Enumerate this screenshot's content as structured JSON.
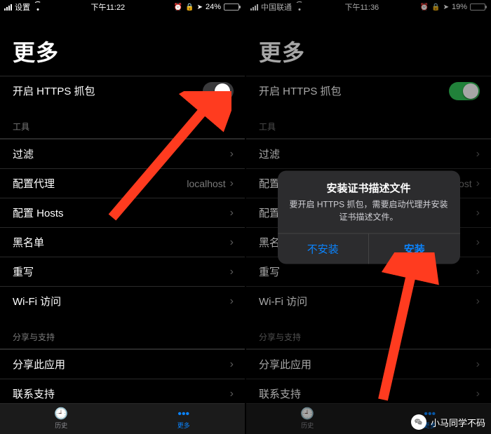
{
  "left": {
    "status": {
      "carrier": "设置",
      "time": "下午11:22",
      "battery_text": "24%",
      "battery_pct": 24,
      "battery_low": false
    },
    "title": "更多",
    "toggle": {
      "label": "开启 HTTPS 抓包",
      "on": false
    },
    "sections": [
      {
        "header": "工具",
        "rows": [
          {
            "label": "过滤",
            "hint": ""
          },
          {
            "label": "配置代理",
            "hint": "localhost"
          },
          {
            "label": "配置 Hosts",
            "hint": ""
          },
          {
            "label": "黑名单",
            "hint": ""
          },
          {
            "label": "重写",
            "hint": ""
          },
          {
            "label": "Wi-Fi 访问",
            "hint": ""
          }
        ]
      },
      {
        "header": "分享与支持",
        "rows": [
          {
            "label": "分享此应用",
            "hint": ""
          },
          {
            "label": "联系支持",
            "hint": ""
          }
        ]
      }
    ],
    "tabs": {
      "history": "历史",
      "more": "更多",
      "active": 1
    }
  },
  "right": {
    "status": {
      "carrier": "中国联通",
      "time": "下午11:36",
      "battery_text": "19%",
      "battery_pct": 19,
      "battery_low": true
    },
    "title": "更多",
    "toggle": {
      "label": "开启 HTTPS 抓包",
      "on": true
    },
    "sections_same_as_left": true,
    "alert": {
      "title": "安装证书描述文件",
      "message": "要开启 HTTPS 抓包，需要启动代理并安装证书描述文件。",
      "cancel": "不安装",
      "confirm": "安装"
    },
    "tabs": {
      "history": "历史",
      "more": "更多",
      "active": 1
    }
  },
  "sections_shared": [
    {
      "header": "工具",
      "rows": [
        {
          "label": "过滤",
          "hint": ""
        },
        {
          "label": "配置代理",
          "hint": "localhost"
        },
        {
          "label": "配置 Hosts",
          "hint": ""
        },
        {
          "label": "黑名单",
          "hint": ""
        },
        {
          "label": "重写",
          "hint": ""
        },
        {
          "label": "Wi-Fi 访问",
          "hint": ""
        }
      ]
    },
    {
      "header": "分享与支持",
      "rows": [
        {
          "label": "分享此应用",
          "hint": ""
        },
        {
          "label": "联系支持",
          "hint": ""
        }
      ]
    }
  ],
  "watermark": "小马同学不码"
}
